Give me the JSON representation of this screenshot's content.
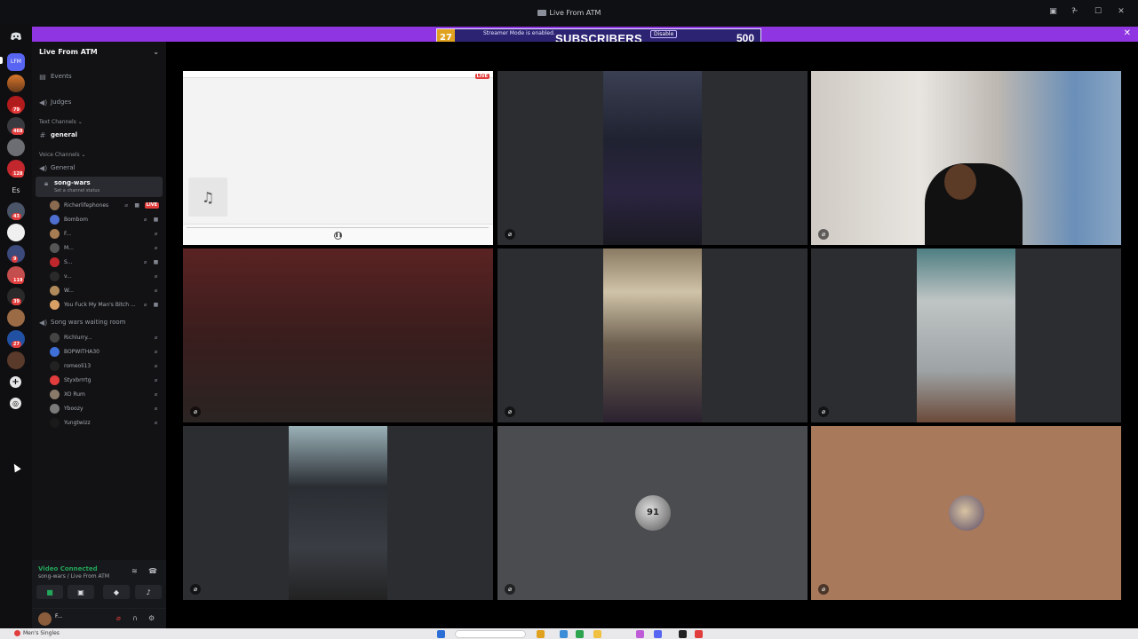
{
  "window": {
    "title": "Live From ATM",
    "server_short": "LFM"
  },
  "streamer": {
    "notice": "Streamer Mode is enabled.",
    "disable_label": "Disable",
    "subs_count": "27",
    "subs_label": "SUBSCRIBERS",
    "subs_goal": "500",
    "close_label": "✕"
  },
  "rail": {
    "server_badges": [
      "79",
      "468",
      "128",
      "43",
      "9",
      "119",
      "39",
      "27"
    ],
    "es_label": "Es"
  },
  "sidebar": {
    "server_name": "Live From ATM",
    "events_label": "Events",
    "judges_label": "Judges",
    "text_category": "Text Channels",
    "general_text": "general",
    "voice_category": "Voice Channels",
    "general_voice": "General",
    "song_wars": "song-wars",
    "song_wars_status": "Set a channel status",
    "song_wars_users": [
      {
        "name": "Richerlifephones",
        "live": "LIVE"
      },
      {
        "name": "Bombom",
        "live": ""
      },
      {
        "name": "F...",
        "live": ""
      },
      {
        "name": "M...",
        "live": ""
      },
      {
        "name": "S...",
        "live": ""
      },
      {
        "name": "v...",
        "live": ""
      },
      {
        "name": "W...",
        "live": ""
      },
      {
        "name": "You Fuck My Man's Bitch ...",
        "live": ""
      }
    ],
    "waiting_room": "Song wars waiting room",
    "waiting_users": [
      {
        "name": "Richlurry..."
      },
      {
        "name": "BOPWITHA30"
      },
      {
        "name": "romeoli13"
      },
      {
        "name": "Styxbrrrtg"
      },
      {
        "name": "XO Rum"
      },
      {
        "name": "Yboozy"
      },
      {
        "name": "Yungtwizz"
      }
    ]
  },
  "voice": {
    "status": "Video Connected",
    "location": "song-wars / Live From ATM",
    "user_name": "F..."
  },
  "tiles": [
    {
      "label": "screen-share",
      "live": "LIVE"
    },
    {
      "label": "camera-2"
    },
    {
      "label": "camera-3"
    },
    {
      "label": "camera-4"
    },
    {
      "label": "camera-5"
    },
    {
      "label": "camera-6"
    },
    {
      "label": "camera-7"
    },
    {
      "label": "avatar-8",
      "avatar_text": "91"
    },
    {
      "label": "avatar-9"
    }
  ],
  "taskbar": {
    "app_label": "Men's Singles"
  }
}
